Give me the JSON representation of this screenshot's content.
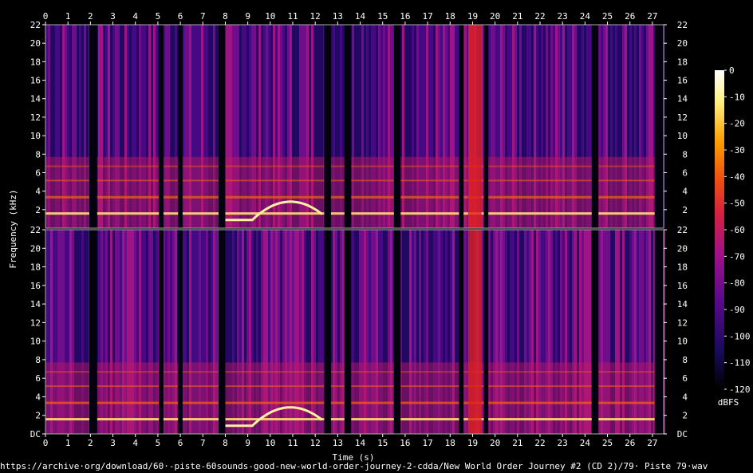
{
  "chart_data": {
    "type": "heatmap",
    "subtype": "spectrogram",
    "xlabel": "Time (s)",
    "ylabel": "Frequency (kHz)",
    "colorbar_label": "dBFS",
    "xlim": [
      0,
      27.5
    ],
    "ylim": [
      0,
      22
    ],
    "x_ticks": [
      "0",
      "1",
      "2",
      "3",
      "4",
      "5",
      "6",
      "7",
      "8",
      "9",
      "10",
      "11",
      "12",
      "13",
      "14",
      "15",
      "16",
      "17",
      "18",
      "19",
      "20",
      "21",
      "22",
      "23",
      "24",
      "25",
      "26",
      "27"
    ],
    "y_ticks": [
      "DC",
      "2",
      "4",
      "6",
      "8",
      "10",
      "12",
      "14",
      "16",
      "18",
      "20",
      "22"
    ],
    "colorbar_ticks": [
      "0",
      "-10",
      "-20",
      "-30",
      "-40",
      "-50",
      "-60",
      "-70",
      "-80",
      "-90",
      "-100",
      "-110",
      "-120"
    ],
    "colorbar_range": [
      -120,
      0
    ],
    "channels": 2,
    "colormap": [
      "#000000",
      "#1a0a5c",
      "#5a0a8c",
      "#a0108a",
      "#d62040",
      "#f05010",
      "#fca000",
      "#fff080",
      "#ffffff"
    ]
  },
  "footer": {
    "source": "https://archive·org/download/60·-piste-60sounds-good-new-world-order-journey-2-cdda/New World Order Journey #2 (CD 2)/79· Piste 79·wav"
  }
}
